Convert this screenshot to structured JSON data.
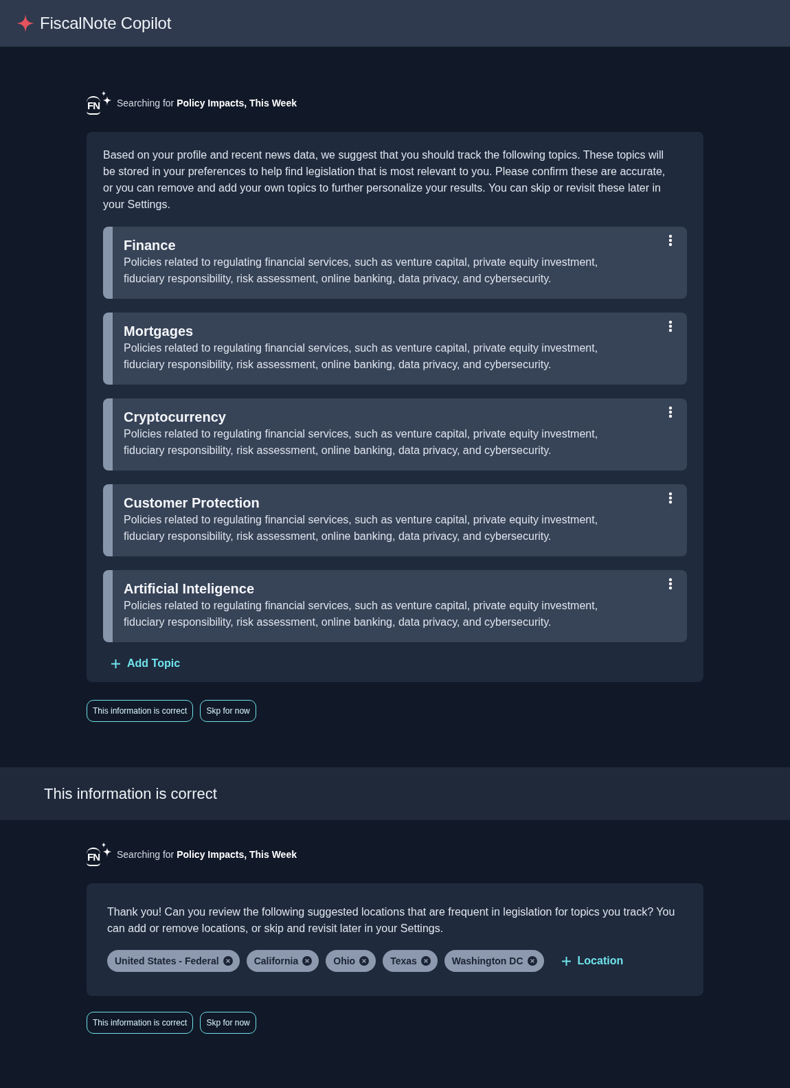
{
  "header": {
    "title": "FiscalNote Copilot"
  },
  "topics_prompt": {
    "logo_text": "FN",
    "status": "Searching for **Policy Impacts, This Week**",
    "message": "Based on your profile and recent news data, we suggest that you should track the following topics. These topics will be stored in your preferences to help find legislation that is most relevant to you. Please confirm these are accurate, or you can remove and add your own topics to further personalize your results. You can skip or revisit these later in your Settings.",
    "topics": [
      {
        "title": "Finance",
        "description": "Policies related to regulating financial services, such as venture capital, private equity investment, fiduciary responsibility, risk assessment, online banking, data privacy, and cybersecurity."
      },
      {
        "title": "Mortgages",
        "description": "Policies related to regulating financial services, such as venture capital, private equity investment, fiduciary responsibility, risk assessment, online banking, data privacy, and cybersecurity."
      },
      {
        "title": "Cryptocurrency",
        "description": "Policies related to regulating financial services, such as venture capital, private equity investment, fiduciary responsibility, risk assessment, online banking, data privacy, and cybersecurity."
      },
      {
        "title": "Customer Protection",
        "description": "Policies related to regulating financial services, such as venture capital, private equity investment, fiduciary responsibility, risk assessment, online banking, data privacy, and cybersecurity."
      },
      {
        "title": "Artificial Inteligence",
        "description": "Policies related to regulating financial services, such as venture capital, private equity investment, fiduciary responsibility, risk assessment, online banking, data privacy, and cybersecurity."
      }
    ],
    "add_button": "Add Topic",
    "actions": [
      "This information is correct",
      "Skp for now"
    ]
  },
  "user_reply": {
    "text": "This information is correct"
  },
  "locations_prompt": {
    "logo_text": "FN",
    "status": "Searching for **Policy Impacts, This Week**",
    "message": "Thank you! Can you review the following suggested locations that are frequent in legislation for topics you track? You can add or remove locations, or skip and revisit later in your Settings.",
    "locations": [
      "United States - Federal",
      "California",
      "Ohio",
      "Texas",
      "Washington DC"
    ],
    "add_button": "Location",
    "actions": [
      "This information is correct",
      "Skp for now"
    ]
  }
}
